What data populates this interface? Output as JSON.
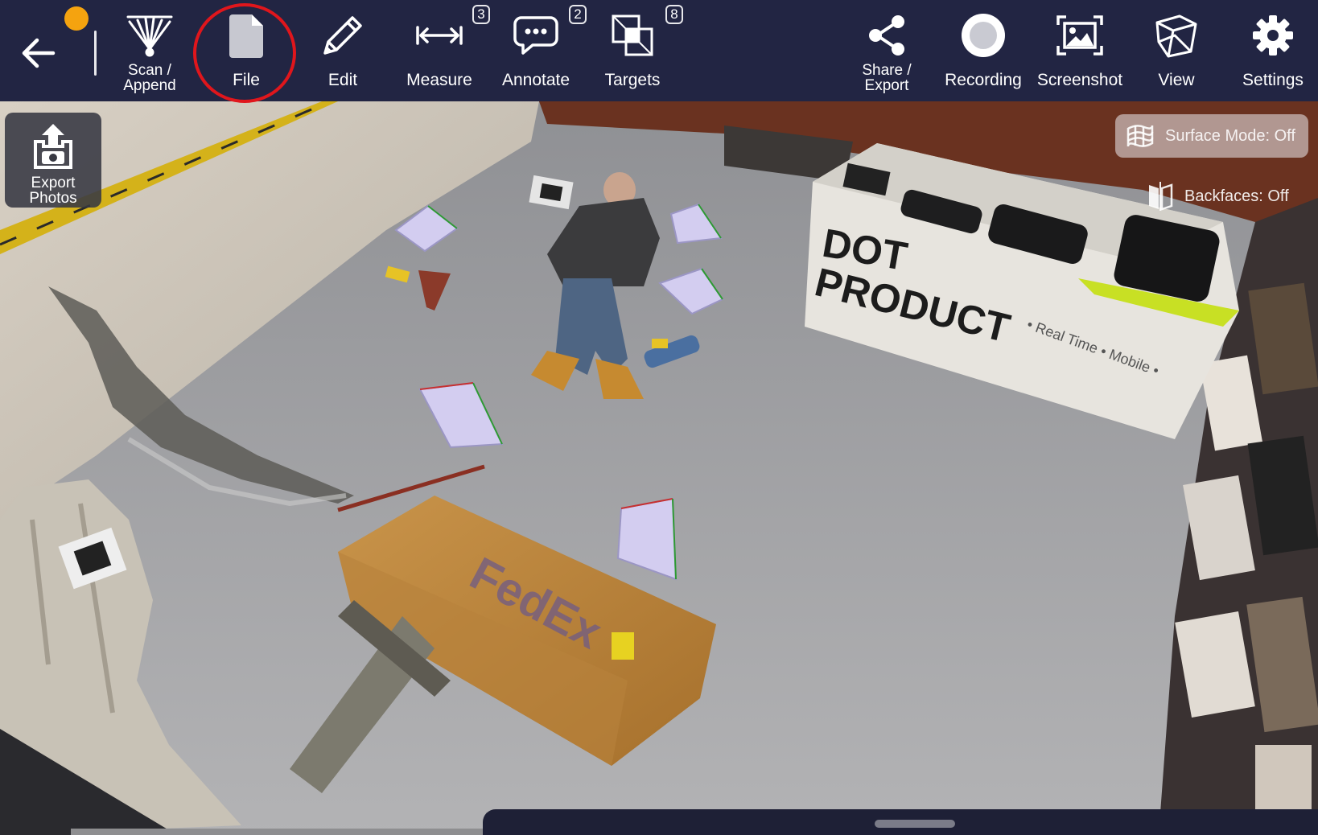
{
  "toolbar": {
    "back_icon": "arrow-left-icon",
    "status_color": "#f5a30f",
    "tools": {
      "scan": {
        "label": "Scan /\nAppend",
        "icon": "scan-fan-icon"
      },
      "file": {
        "label": "File",
        "icon": "file-icon"
      },
      "edit": {
        "label": "Edit",
        "icon": "pencil-icon"
      },
      "measure": {
        "label": "Measure",
        "icon": "measure-arrows-icon",
        "count": "3"
      },
      "annotate": {
        "label": "Annotate",
        "icon": "speech-bubble-icon",
        "count": "2"
      },
      "targets": {
        "label": "Targets",
        "icon": "target-squares-icon",
        "count": "8"
      },
      "share": {
        "label": "Share /\nExport",
        "icon": "share-icon"
      },
      "recording": {
        "label": "Recording",
        "icon": "record-icon"
      },
      "screenshot": {
        "label": "Screenshot",
        "icon": "screenshot-icon"
      },
      "view": {
        "label": "View",
        "icon": "cube-icon"
      },
      "settings": {
        "label": "Settings",
        "icon": "gear-icon"
      }
    }
  },
  "viewport": {
    "export_photos": {
      "label": "Export\nPhotos",
      "icon": "export-photos-icon"
    },
    "surface_mode": {
      "label": "Surface Mode: Off",
      "icon": "surface-grid-icon"
    },
    "backfaces": {
      "label": "Backfaces: Off",
      "icon": "backfaces-icon"
    },
    "scene_text": {
      "banner_brand_line1": "DOT",
      "banner_brand_line2": "PRODUCT",
      "banner_tagline": "• Real Time • Mobile •",
      "box_brand": "FedEx"
    }
  },
  "colors": {
    "toolbar": "#222543",
    "highlight_ring": "#e0161c",
    "accent": "#f5a30f"
  }
}
